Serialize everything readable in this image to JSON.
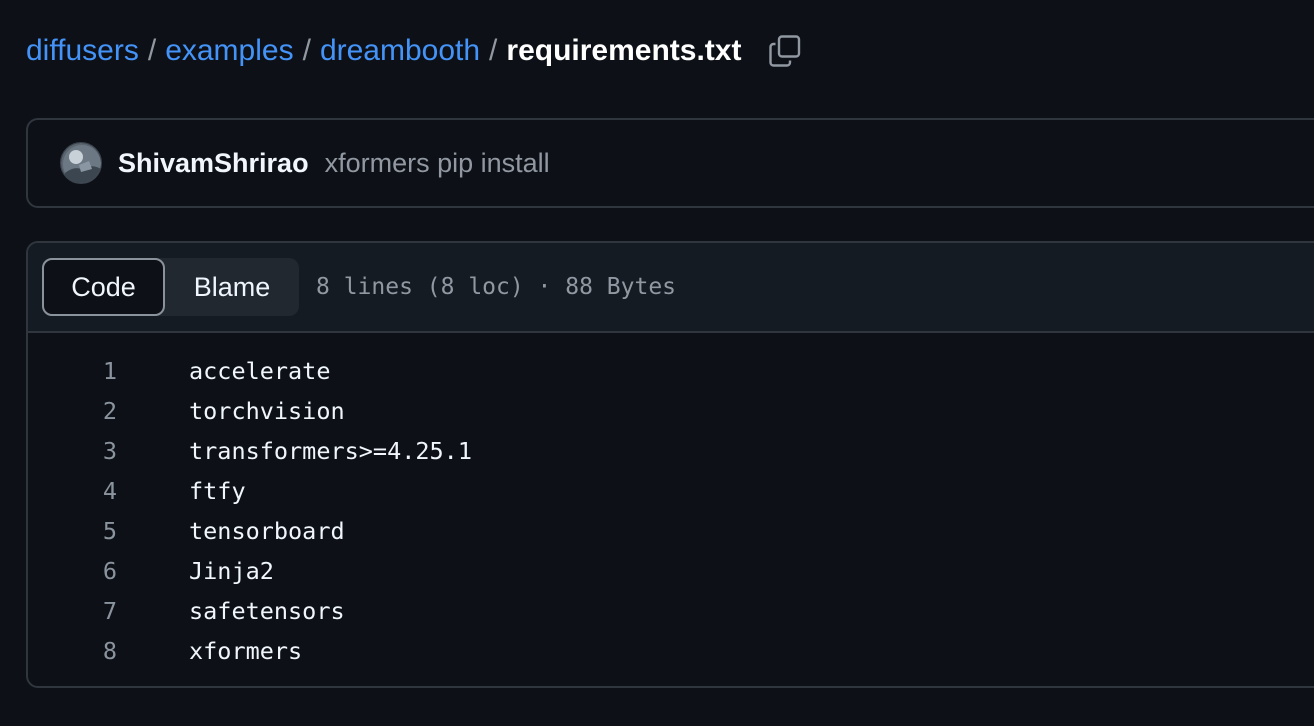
{
  "breadcrumb": {
    "items": [
      "diffusers",
      "examples",
      "dreambooth"
    ],
    "separator": "/",
    "current": "requirements.txt",
    "copy_icon": "copy-icon"
  },
  "commit": {
    "author": "ShivamShrirao",
    "message": "xformers pip install"
  },
  "file": {
    "tabs": [
      "Code",
      "Blame"
    ],
    "active_tab": "Code",
    "meta": "8 lines (8 loc) · 88 Bytes",
    "lines": [
      {
        "num": "1",
        "text": "accelerate"
      },
      {
        "num": "2",
        "text": "torchvision"
      },
      {
        "num": "3",
        "text": "transformers>=4.25.1"
      },
      {
        "num": "4",
        "text": "ftfy"
      },
      {
        "num": "5",
        "text": "tensorboard"
      },
      {
        "num": "6",
        "text": "Jinja2"
      },
      {
        "num": "7",
        "text": "safetensors"
      },
      {
        "num": "8",
        "text": "xformers"
      }
    ]
  },
  "colors": {
    "background": "#0d1117",
    "link": "#4493f8",
    "muted": "#9198a1",
    "border": "#30363d"
  }
}
